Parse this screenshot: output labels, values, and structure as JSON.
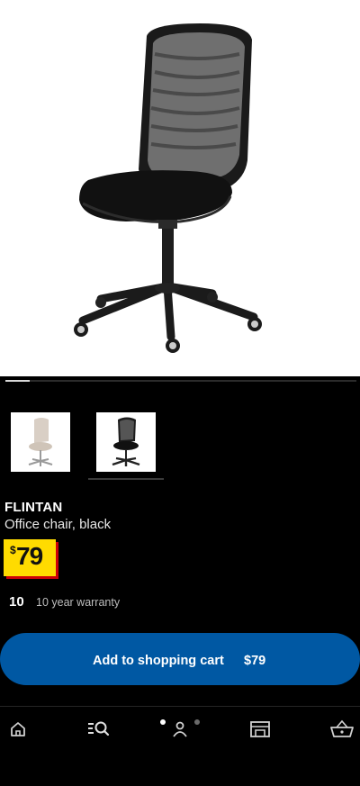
{
  "product": {
    "brand": "FLINTAN",
    "description": "Office chair, black",
    "price_currency": "$",
    "price_amount": "79",
    "warranty_years": "10",
    "warranty_text": "10 year warranty"
  },
  "gallery": {
    "progress": 0.07,
    "thumbnails": [
      {
        "name": "beige-white chair",
        "selected": false
      },
      {
        "name": "black chair",
        "selected": true
      }
    ]
  },
  "cart_button": {
    "label": "Add to shopping cart",
    "price": "$79"
  },
  "bottom_nav": {
    "items": [
      "home-icon",
      "search-icon",
      "profile-icon",
      "store-icon",
      "basket-icon"
    ],
    "dots": 2,
    "active_dot": 0
  },
  "colors": {
    "price_yellow": "#ffdb00",
    "price_red": "#cc0008",
    "button_blue": "#0058a3",
    "background": "#000000"
  }
}
